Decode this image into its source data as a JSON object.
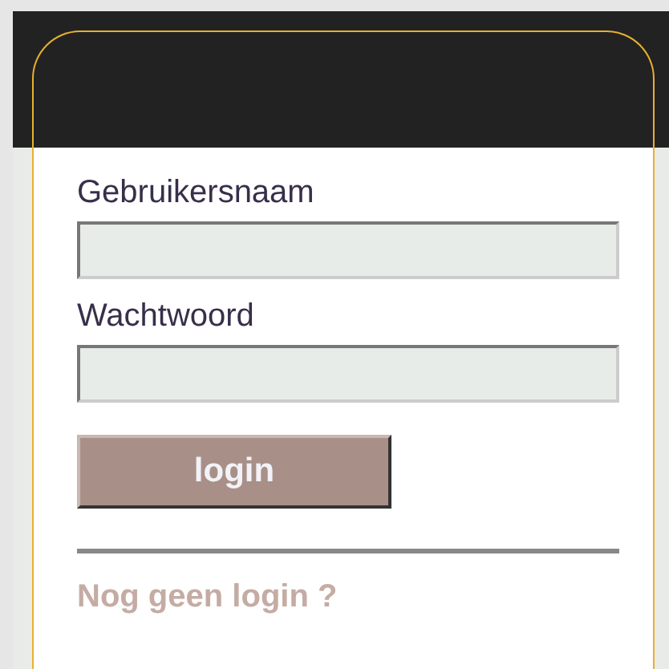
{
  "login_form": {
    "fields": [
      {
        "label": "Gebruikersnaam"
      },
      {
        "label": "Wachtwoord"
      }
    ],
    "submit_button": "login",
    "signup_link": "Nog geen login ?"
  }
}
